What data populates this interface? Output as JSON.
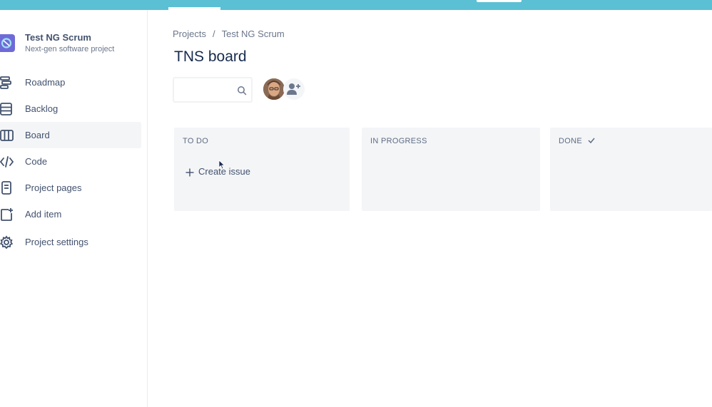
{
  "project": {
    "name": "Test NG Scrum",
    "type": "Next-gen software project"
  },
  "sidebar": {
    "items": [
      {
        "label": "Roadmap",
        "icon": "roadmap-icon"
      },
      {
        "label": "Backlog",
        "icon": "backlog-icon"
      },
      {
        "label": "Board",
        "icon": "board-icon",
        "active": true
      },
      {
        "label": "Code",
        "icon": "code-icon"
      },
      {
        "label": "Project pages",
        "icon": "page-icon"
      },
      {
        "label": "Add item",
        "icon": "add-item-icon"
      },
      {
        "label": "Project settings",
        "icon": "gear-icon"
      }
    ]
  },
  "breadcrumb": {
    "root": "Projects",
    "separator": "/",
    "current": "Test NG Scrum"
  },
  "board": {
    "title": "TNS board",
    "search_placeholder": "",
    "columns": [
      {
        "title": "TO DO"
      },
      {
        "title": "IN PROGRESS"
      },
      {
        "title": "DONE"
      }
    ],
    "create_issue_label": "Create issue"
  },
  "colors": {
    "topbar": "#5bc0d3",
    "column_bg": "#f4f5f7",
    "text_primary": "#172b4d",
    "text_secondary": "#42526e"
  }
}
